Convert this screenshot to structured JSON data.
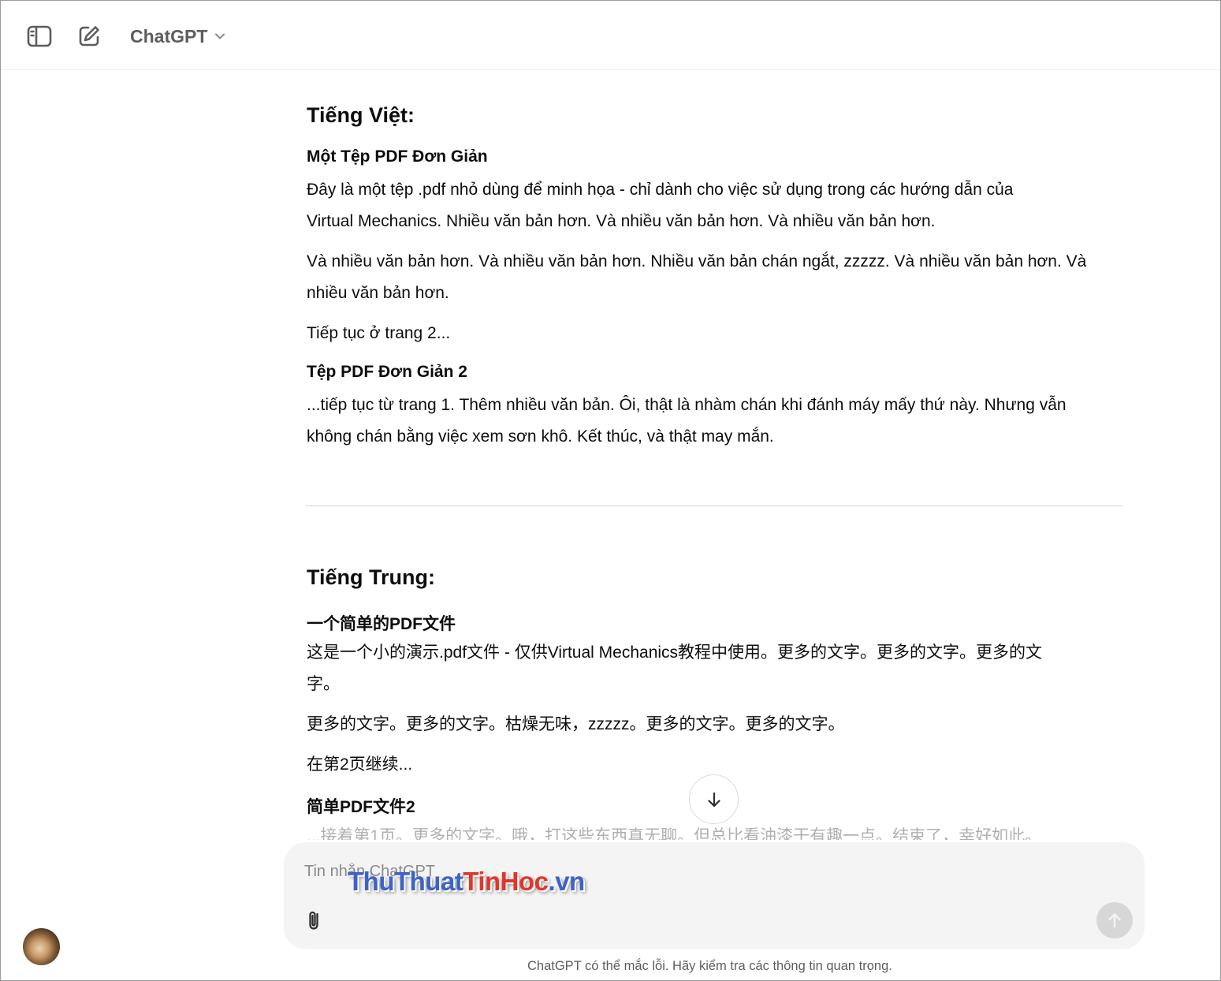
{
  "header": {
    "model_name": "ChatGPT",
    "icons": {
      "sidebar": "sidebar-toggle-icon",
      "new_chat": "new-chat-icon",
      "chevron": "chevron-down-icon"
    }
  },
  "conversation": {
    "vietnamese": {
      "heading": "Tiếng Việt:",
      "doc1_title": "Một Tệp PDF Đơn Giản",
      "p1_line1": "Đây là một tệp .pdf nhỏ dùng để minh họa - chỉ dành cho việc sử dụng trong các hướng dẫn của",
      "p1_line2": "Virtual Mechanics. Nhiều văn bản hơn. Và nhiều văn bản hơn. Và nhiều văn bản hơn.",
      "p2_line1": "Và nhiều văn bản hơn. Và nhiều văn bản hơn. Nhiều văn bản chán ngắt, zzzzz. Và nhiều văn bản hơn. Và",
      "p2_line2": "nhiều văn bản hơn.",
      "p3": "Tiếp tục ở trang 2...",
      "doc2_title": "Tệp PDF Đơn Giản 2",
      "p4_line1": "...tiếp tục từ trang 1. Thêm nhiều văn bản. Ôi, thật là nhàm chán khi đánh máy mấy thứ này. Nhưng vẫn",
      "p4_line2": "không chán bằng việc xem sơn khô. Kết thúc, và thật may mắn."
    },
    "chinese": {
      "heading": "Tiếng Trung:",
      "doc1_title": "一个简单的PDF文件",
      "p1_line1": "这是一个小的演示.pdf文件 - 仅供Virtual Mechanics教程中使用。更多的文字。更多的文字。更多的文",
      "p1_line2": "字。",
      "p2": "更多的文字。更多的文字。枯燥无味，zzzzz。更多的文字。更多的文字。",
      "p3": "在第2页继续...",
      "doc2_title": "简单PDF文件2",
      "p4_partial": "...接着第1页。更多的文字。哦，打这些东西真无聊。但总比看油漆干有趣一点。结束了，幸好如此。"
    }
  },
  "composer": {
    "placeholder": "Tin nhắn ChatGPT",
    "value": "",
    "icons": {
      "attach": "paperclip-icon",
      "send": "arrow-up-icon"
    }
  },
  "scroll_button": {
    "icon": "arrow-down-icon"
  },
  "watermark": {
    "part1": "ThuThuat",
    "part2": "TinHoc",
    "part3": ".vn"
  },
  "footer": {
    "disclaimer": "ChatGPT có thể mắc lỗi. Hãy kiểm tra các thông tin quan trọng."
  },
  "user": {
    "avatar": "user-avatar"
  },
  "colors": {
    "text": "#0d0d0d",
    "muted": "#5d5d5d",
    "composer_bg": "#f4f4f4",
    "send_disabled": "#d7d7d7",
    "watermark_blue": "#3d63c9",
    "watermark_red": "#e2362b"
  }
}
